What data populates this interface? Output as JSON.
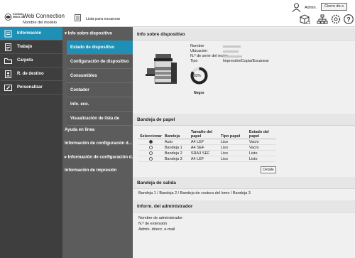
{
  "header": {
    "app_title": "Web Connection",
    "model_name": "Nombre del modelo",
    "scan_list": "Lista para escanear",
    "user": "Admin.",
    "logout": "Cierre de s",
    "icons": [
      "logo-mark",
      "user-icon",
      "printer-refresh-icon",
      "network-icon",
      "settings-icon",
      "help-icon"
    ]
  },
  "sidebar": {
    "items": [
      {
        "label": "Información",
        "icon": "info-icon"
      },
      {
        "label": "Trabajo",
        "icon": "job-icon"
      },
      {
        "label": "Carpeta",
        "icon": "folder-icon"
      },
      {
        "label": "R. de destino",
        "icon": "address-book-icon"
      },
      {
        "label": "Personalizar",
        "icon": "customize-icon"
      }
    ]
  },
  "submenu": {
    "items": [
      {
        "label": "▾ Info sobre dispositivo"
      },
      {
        "label": "Estado de dispositivo"
      },
      {
        "label": "Configuración de dispositivo"
      },
      {
        "label": "Consumibles"
      },
      {
        "label": "Contador"
      },
      {
        "label": "Info. eco."
      },
      {
        "label": "Visualización de lista de"
      },
      {
        "label": "Ayuda en línea"
      },
      {
        "label": "Información de configuración d..."
      },
      {
        "label": "▸ Información de configuración d..."
      },
      {
        "label": "Información de impresión"
      }
    ]
  },
  "main": {
    "info_title": "Info sobre dispositivo",
    "device_fields": {
      "name_label": "Nombre",
      "location_label": "Ubicación",
      "serial_label": "N.º de serie del motor",
      "type_label": "Tipo",
      "type_value": "Impresión/Copia/Escanear"
    },
    "toner": {
      "percent_label": "83%",
      "color": "Negro",
      "level": 0.83
    },
    "tray_title": "Bandeja de papel",
    "tray_table": {
      "headers": [
        "Seleccionar",
        "Bandeja",
        "Tamaño del papel",
        "Tipo papel",
        "Estado del papel"
      ],
      "rows": [
        {
          "tray": "Auto",
          "size": "A4 LEF",
          "type": "Liso",
          "status": "Vacío",
          "selected": true
        },
        {
          "tray": "Bandeja 1",
          "size": "A4 SEF",
          "type": "Liso",
          "status": "Vacío",
          "selected": false
        },
        {
          "tray": "Bandeja 2",
          "size": "SRA3 SEF",
          "type": "Liso",
          "status": "Listo",
          "selected": false
        },
        {
          "tray": "Bandeja 3",
          "size": "A4 LEF",
          "type": "Liso",
          "status": "Listo",
          "selected": false
        }
      ]
    },
    "detail_button": "Detalle",
    "output_title": "Bandeja de salida",
    "output_value": "Bandeja 1 / Bandeja 2 / Bandeja de costura del lomo / Bandeja 3",
    "admin_title": "Inform. del administrador",
    "admin_fields": {
      "name": "Nombre de administrador",
      "extension": "N.º de extensión",
      "email": "Admin. direcc. e-mail"
    }
  },
  "colors": {
    "accent": "#1e8fb5",
    "sidebar_bg": "#3e3e3e",
    "submenu_bg": "#5c5c5c",
    "main_bg": "#f0f0f0"
  }
}
